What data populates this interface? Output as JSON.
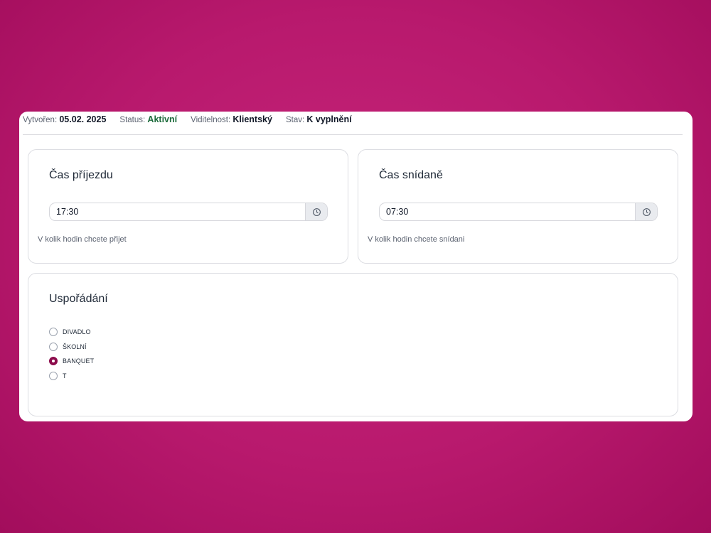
{
  "meta": {
    "created_label": "Vytvořen:",
    "created_value": "05.02. 2025",
    "status_label": "Status:",
    "status_value": "Aktivní",
    "visibility_label": "Viditelnost:",
    "visibility_value": "Klientský",
    "state_label": "Stav:",
    "state_value": "K vyplnění"
  },
  "arrival": {
    "title": "Čas příjezdu",
    "value": "17:30",
    "hint": "V kolik hodin chcete přijet",
    "icon": "clock-icon"
  },
  "breakfast": {
    "title": "Čas snídaně",
    "value": "07:30",
    "hint": "V kolik hodin chcete snídani",
    "icon": "clock-icon"
  },
  "layout": {
    "title": "Uspořádání",
    "options": [
      {
        "label": "DIVADLO",
        "checked": false
      },
      {
        "label": "ŠKOLNÍ",
        "checked": false
      },
      {
        "label": "BANQUET",
        "checked": true
      },
      {
        "label": "T",
        "checked": false
      }
    ]
  },
  "colors": {
    "background": "#b8196d",
    "accent": "#8c0c4c",
    "active_status": "#1c6b3b"
  }
}
